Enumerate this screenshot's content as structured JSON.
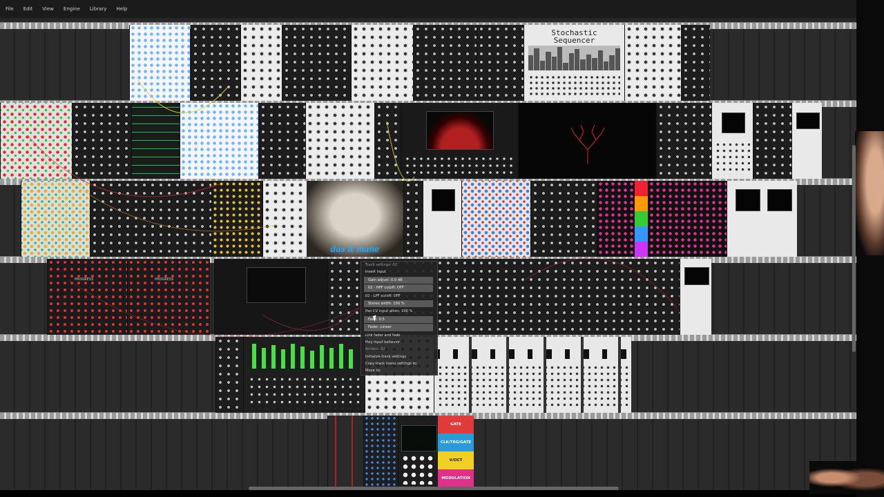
{
  "menubar": {
    "items": [
      "File",
      "Edit",
      "View",
      "Engine",
      "Library",
      "Help"
    ]
  },
  "modules": {
    "stochastic_title_line1": "Stochastic",
    "stochastic_title_line2": "Sequencer",
    "photo_caption": "das it mane",
    "progress_left": "PROGRESS",
    "progress_right": "PROGRESS"
  },
  "context_menu": {
    "items": [
      {
        "label": "Track settings: 02",
        "type": "header"
      },
      {
        "label": "Insert input",
        "type": "item"
      },
      {
        "label": "Gain adjust: 0.0 dB",
        "type": "slider"
      },
      {
        "label": "02 - HPF cutoff: OFF",
        "type": "slider"
      },
      {
        "label": "02 - LPF cutoff: OFF",
        "type": "item"
      },
      {
        "label": "Stereo width: 100 %",
        "type": "slider"
      },
      {
        "label": "Pan CV input atten: 100 %",
        "type": "item"
      },
      {
        "label": "Fade: 0.5",
        "type": "slider"
      },
      {
        "label": "Fader: Linear",
        "type": "slider"
      },
      {
        "label": "Link fader and fade",
        "type": "item"
      },
      {
        "label": "Poly input behavior",
        "type": "item"
      },
      {
        "label": "Actions: 02",
        "type": "header"
      },
      {
        "label": "Initialize track settings",
        "type": "item"
      },
      {
        "label": "Copy track menu settings to:",
        "type": "item"
      },
      {
        "label": "Move to:",
        "type": "item"
      }
    ]
  },
  "labels": {
    "gate": "GATE",
    "clk_trg_gate": "CLK/TRG/GATE",
    "voct": "V/OCT",
    "modulation": "MODULATION"
  },
  "colors": {
    "gate": "#e03a3a",
    "clk_trg_gate": "#2a9ad8",
    "voct": "#f0d020",
    "modulation": "#e0308a"
  }
}
